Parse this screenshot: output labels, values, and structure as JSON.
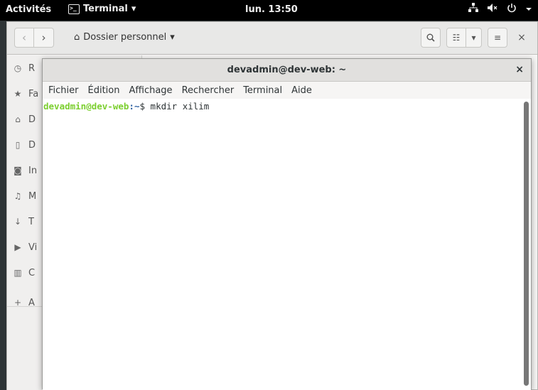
{
  "topbar": {
    "activities": "Activités",
    "app_name": "Terminal",
    "app_arrow": "▾",
    "clock": "lun. 13:50",
    "tray_icons": [
      "network-icon",
      "volume-muted-icon",
      "power-icon",
      "chevron-down-icon"
    ]
  },
  "files": {
    "back_glyph": "‹",
    "forward_glyph": "›",
    "path_icon": "⌂",
    "path_label": "Dossier personnel",
    "path_arrow": "▾",
    "search_glyph": "⚲",
    "view_glyph": "☷",
    "view_arrow": "▾",
    "menu_glyph": "≡",
    "close_glyph": "×",
    "sidebar": [
      {
        "icon": "◷",
        "label": "R"
      },
      {
        "icon": "★",
        "label": "Fa"
      },
      {
        "icon": "⌂",
        "label": "D"
      },
      {
        "icon": "▯",
        "label": "D"
      },
      {
        "icon": "◙",
        "label": "In"
      },
      {
        "icon": "♫",
        "label": "M"
      },
      {
        "icon": "↓",
        "label": "T"
      },
      {
        "icon": "▶",
        "label": "Vi"
      },
      {
        "icon": "▥",
        "label": "C"
      },
      {
        "icon": "+",
        "label": "A"
      }
    ]
  },
  "terminal": {
    "title": "devadmin@dev-web: ~",
    "close_glyph": "×",
    "menu": [
      "Fichier",
      "Édition",
      "Affichage",
      "Rechercher",
      "Terminal",
      "Aide"
    ],
    "prompt_user": "devadmin@dev-web",
    "prompt_path": ":~",
    "prompt_symbol": "$ ",
    "command": "mkdir xilim"
  }
}
